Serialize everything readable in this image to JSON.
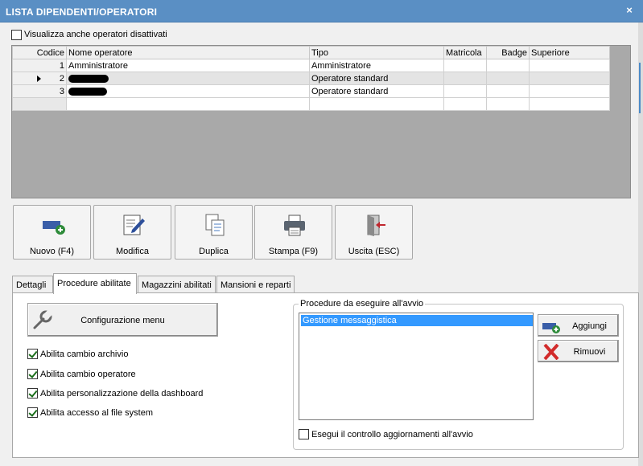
{
  "window": {
    "title": "LISTA DIPENDENTI/OPERATORI",
    "close_glyph": "×"
  },
  "show_disabled": {
    "label": "Visualizza anche operatori disattivati",
    "checked": false
  },
  "grid": {
    "columns": [
      "Codice",
      "Nome operatore",
      "Tipo",
      "Matricola",
      "Badge",
      "Superiore"
    ],
    "rows": [
      {
        "codice": "1",
        "nome": "Amministratore",
        "tipo": "Amministratore",
        "matricola": "",
        "badge": "",
        "superiore": ""
      },
      {
        "codice": "2",
        "nome": "",
        "tipo": "Operatore standard",
        "matricola": "",
        "badge": "",
        "superiore": "",
        "current": true
      },
      {
        "codice": "3",
        "nome": "",
        "tipo": "Operatore standard",
        "matricola": "",
        "badge": "",
        "superiore": ""
      }
    ]
  },
  "toolbar": {
    "nuovo": "Nuovo (F4)",
    "modifica": "Modifica",
    "duplica": "Duplica",
    "stampa": "Stampa (F9)",
    "uscita": "Uscita (ESC)"
  },
  "tabs": [
    "Dettagli",
    "Procedure abilitate",
    "Magazzini abilitati",
    "Mansioni e reparti"
  ],
  "active_tab": "Procedure abilitate",
  "procedure": {
    "config_menu": "Configurazione menu",
    "options": [
      {
        "label": "Abilita cambio archivio",
        "checked": true
      },
      {
        "label": "Abilita cambio operatore",
        "checked": true
      },
      {
        "label": "Abilita personalizzazione della dashboard",
        "checked": true
      },
      {
        "label": "Abilita accesso al file system",
        "checked": true
      }
    ],
    "startup_group": {
      "title": "Procedure da eseguire all'avvio",
      "items": [
        "Gestione messaggistica"
      ],
      "add_label": "Aggiungi",
      "remove_label": "Rimuovi",
      "check_updates": {
        "label": "Esegui il controllo aggiornamenti all'avvio",
        "checked": false
      }
    }
  },
  "colors": {
    "titlebar": "#5a8fc4",
    "selection": "#3399ff",
    "grid_bg": "#a9a9a9"
  }
}
